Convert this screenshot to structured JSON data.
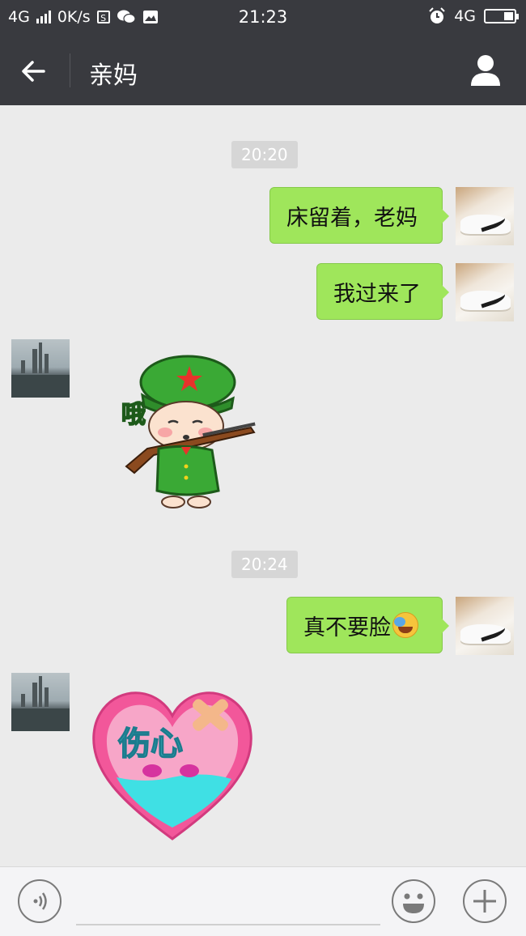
{
  "status_bar": {
    "network_left": "4G",
    "speed": "0K/s",
    "time": "21:23",
    "network_right": "4G",
    "icons": [
      "signal-icon",
      "s-app-icon",
      "wechat-icon",
      "image-icon",
      "alarm-icon",
      "battery-icon"
    ]
  },
  "nav": {
    "title": "亲妈",
    "back_icon": "arrow-left-icon",
    "profile_icon": "person-icon"
  },
  "chat": {
    "timestamps": [
      "20:20",
      "20:24"
    ],
    "messages": [
      {
        "side": "right",
        "type": "text",
        "text": "床留着，老妈"
      },
      {
        "side": "right",
        "type": "text",
        "text": "我过来了"
      },
      {
        "side": "left",
        "type": "sticker",
        "sticker_text": "哦"
      },
      {
        "side": "right",
        "type": "text",
        "text": "真不要脸",
        "emoji": "crying-laughing-emoji"
      },
      {
        "side": "left",
        "type": "sticker",
        "sticker_text": "伤心"
      }
    ]
  },
  "input_bar": {
    "voice_icon": "voice-icon",
    "emoji_icon": "smiley-icon",
    "plus_icon": "plus-icon"
  },
  "colors": {
    "bar": "#393a3f",
    "chat_bg": "#ebebeb",
    "bubble": "#9fe65b",
    "timestamp_bg": "#d6d6d6"
  }
}
